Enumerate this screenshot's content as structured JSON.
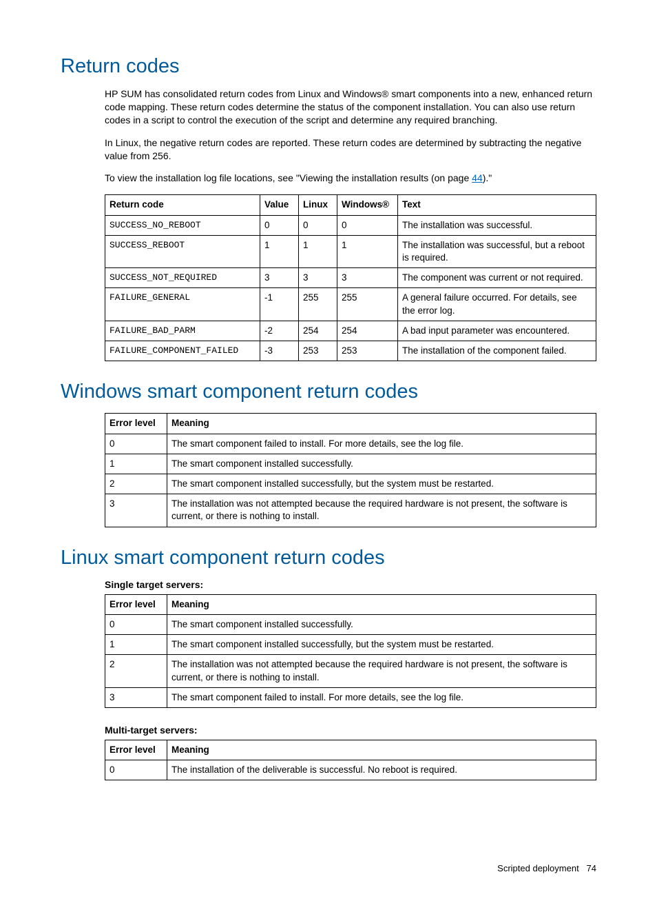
{
  "headings": {
    "return_codes": "Return codes",
    "windows": "Windows smart component return codes",
    "linux": "Linux smart component return codes"
  },
  "paragraphs": {
    "p1": "HP SUM has consolidated return codes from Linux and Windows® smart components into a new, enhanced return code mapping. These return codes determine the status of the component installation. You can also use return codes in a script to control the execution of the script and determine any required branching.",
    "p2": "In Linux, the negative return codes are reported. These return codes are determined by subtracting the negative value from 256.",
    "p3_pre": "To view the installation log file locations, see \"Viewing the installation results (on page ",
    "p3_link": "44",
    "p3_post": ").\""
  },
  "t1": {
    "h0": "Return code",
    "h1": "Value",
    "h2": "Linux",
    "h3": "Windows®",
    "h4": "Text",
    "r0c0": "SUCCESS_NO_REBOOT",
    "r0c1": "0",
    "r0c2": "0",
    "r0c3": "0",
    "r0c4": "The installation was successful.",
    "r1c0": "SUCCESS_REBOOT",
    "r1c1": "1",
    "r1c2": "1",
    "r1c3": "1",
    "r1c4": "The installation was successful, but a reboot is required.",
    "r2c0": "SUCCESS_NOT_REQUIRED",
    "r2c1": "3",
    "r2c2": "3",
    "r2c3": "3",
    "r2c4": "The component was current or not required.",
    "r3c0": "FAILURE_GENERAL",
    "r3c1": "-1",
    "r3c2": "255",
    "r3c3": "255",
    "r3c4": "A general failure occurred. For details, see the error log.",
    "r4c0": "FAILURE_BAD_PARM",
    "r4c1": "-2",
    "r4c2": "254",
    "r4c3": "254",
    "r4c4": "A bad input parameter was encountered.",
    "r5c0": "FAILURE_COMPONENT_FAILED",
    "r5c1": "-3",
    "r5c2": "253",
    "r5c3": "253",
    "r5c4": "The installation of the component failed."
  },
  "t2": {
    "h0": "Error level",
    "h1": "Meaning",
    "r0c0": "0",
    "r0c1": "The smart component failed to install. For more details, see the log file.",
    "r1c0": "1",
    "r1c1": "The smart component installed successfully.",
    "r2c0": "2",
    "r2c1": "The smart component installed successfully, but the system must be restarted.",
    "r3c0": "3",
    "r3c1": "The installation was not attempted because the required hardware is not present, the software is current, or there is nothing to install."
  },
  "linux_sub": {
    "single": "Single target servers:",
    "multi": "Multi-target servers:"
  },
  "t3": {
    "h0": "Error level",
    "h1": "Meaning",
    "r0c0": "0",
    "r0c1": "The smart component installed successfully.",
    "r1c0": "1",
    "r1c1": "The smart component installed successfully, but the system must be restarted.",
    "r2c0": "2",
    "r2c1": "The installation was not attempted because the required hardware is not present, the software is current, or there is nothing to install.",
    "r3c0": "3",
    "r3c1": "The smart component failed to install. For more details, see the log file."
  },
  "t4": {
    "h0": "Error level",
    "h1": "Meaning",
    "r0c0": "0",
    "r0c1": "The installation of the deliverable is successful. No reboot is required."
  },
  "footer": {
    "section": "Scripted deployment",
    "page": "74"
  }
}
